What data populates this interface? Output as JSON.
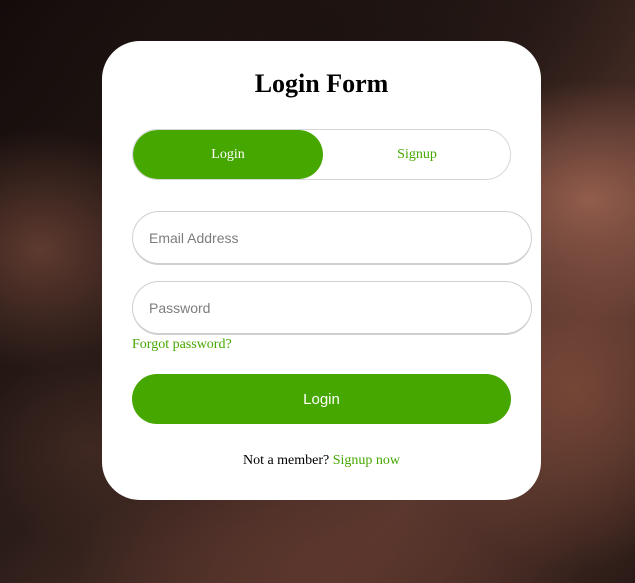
{
  "form": {
    "title": "Login Form",
    "tabs": [
      {
        "label": "Login",
        "active": true
      },
      {
        "label": "Signup",
        "active": false
      }
    ],
    "email": {
      "placeholder": "Email Address",
      "value": ""
    },
    "password": {
      "placeholder": "Password",
      "value": ""
    },
    "forgot_link": "Forgot password?",
    "submit_label": "Login",
    "footer": {
      "text": "Not a member?",
      "link": "Signup now"
    }
  },
  "colors": {
    "accent": "#46a700",
    "card_background": "#ffffff",
    "text": "#000000",
    "placeholder": "#7d7d7d"
  }
}
